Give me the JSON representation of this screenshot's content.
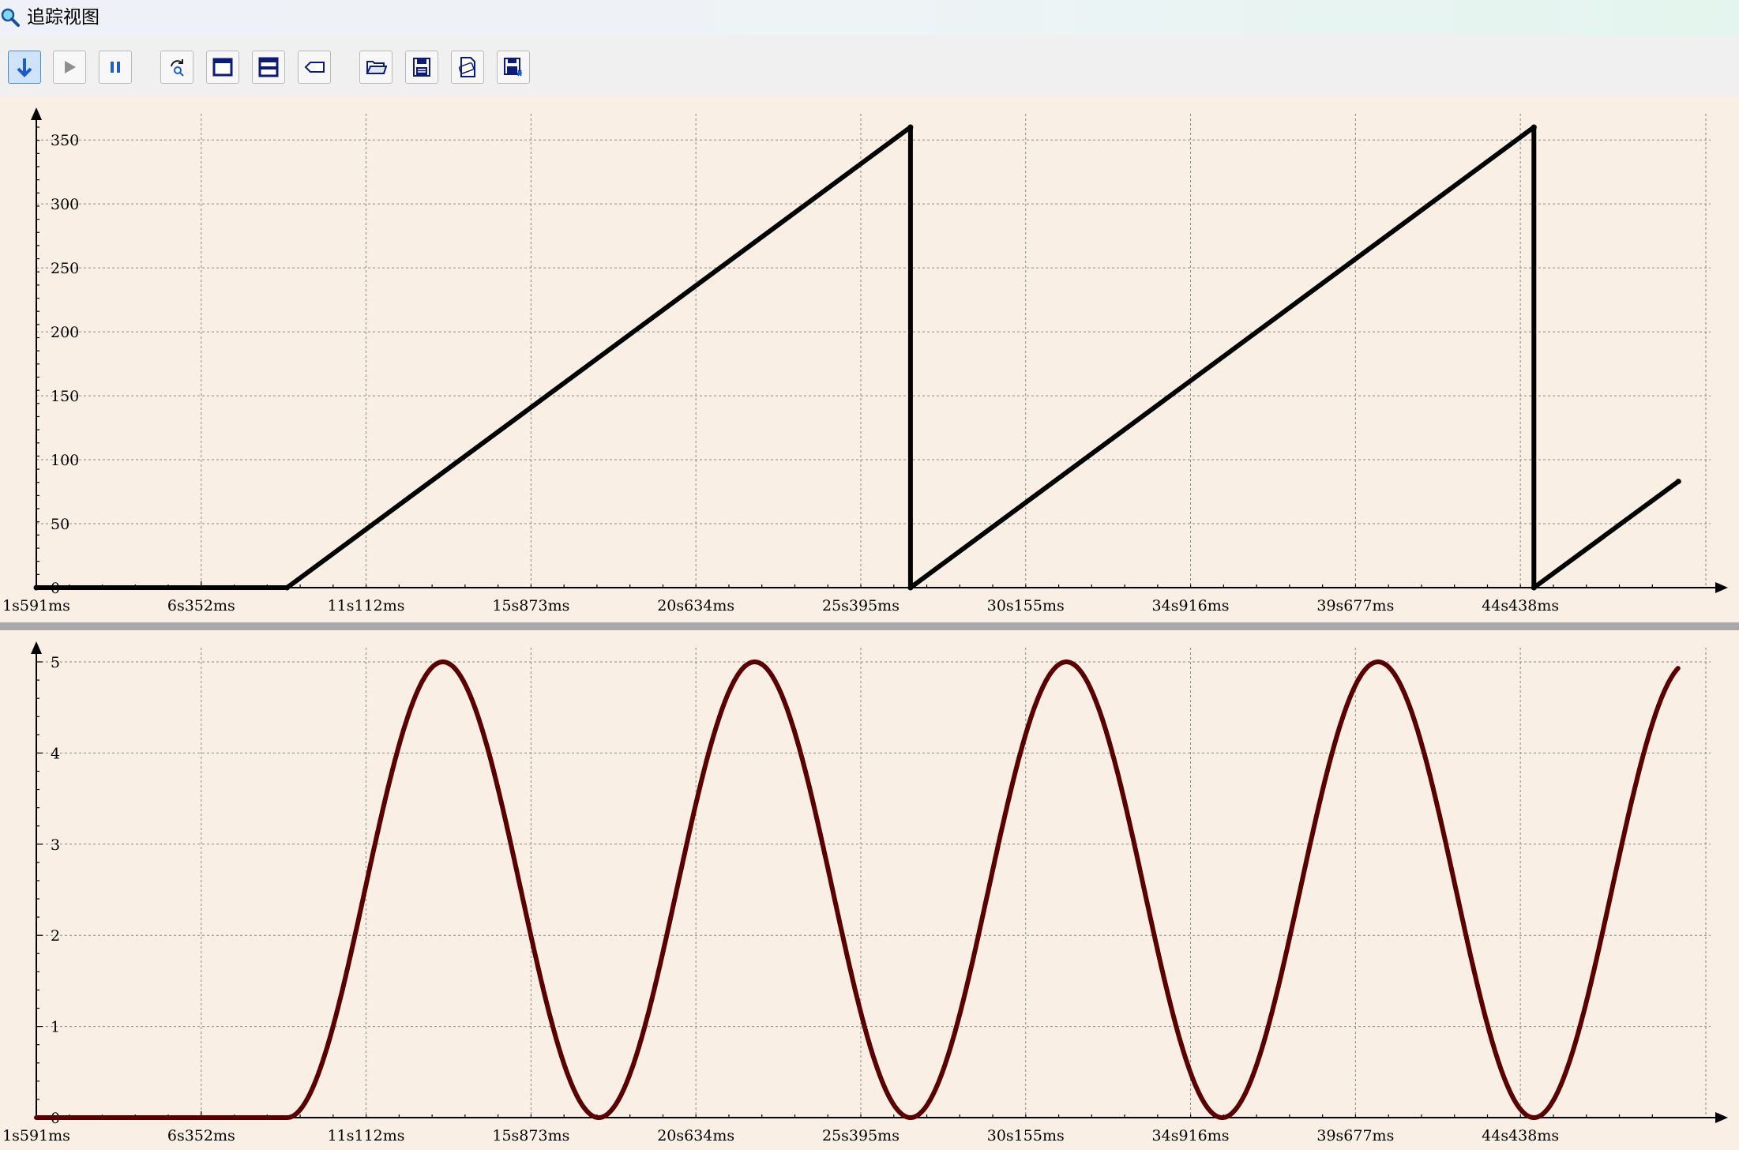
{
  "window": {
    "title": "追踪视图"
  },
  "toolbar": {
    "buttons": [
      {
        "name": "scroll-down-button",
        "icon": "arrow-down-icon",
        "active": true
      },
      {
        "name": "run-button",
        "icon": "play-icon",
        "active": false
      },
      {
        "name": "pause-button",
        "icon": "pause-icon",
        "active": false
      },
      {
        "name": "refresh-button",
        "icon": "refresh-icon",
        "active": false
      },
      {
        "name": "single-view-button",
        "icon": "single-window-icon",
        "active": false
      },
      {
        "name": "split-view-button",
        "icon": "split-window-icon",
        "active": false
      },
      {
        "name": "tag-button",
        "icon": "tag-icon",
        "active": false
      },
      {
        "name": "open-button",
        "icon": "folder-open-icon",
        "active": false
      },
      {
        "name": "save-button",
        "icon": "save-icon",
        "active": false
      },
      {
        "name": "export-csv-button",
        "icon": "csv-file-icon",
        "active": false
      },
      {
        "name": "save-as-button",
        "icon": "save-as-icon",
        "active": false
      }
    ]
  },
  "colors": {
    "background": "#f9efe4",
    "grid": "#8a8a8a",
    "axis": "#000000"
  },
  "chart_data": [
    {
      "type": "line",
      "grid": true,
      "x_tick_labels": [
        "1s591ms",
        "6s352ms",
        "11s112ms",
        "15s873ms",
        "20s634ms",
        "25s395ms",
        "30s155ms",
        "34s916ms",
        "39s677ms",
        "44s438ms"
      ],
      "x_tick_values_ms": [
        1591,
        6352,
        11112,
        15873,
        20634,
        25395,
        30155,
        34916,
        39677,
        44438
      ],
      "xlim_ms": [
        1591,
        49200
      ],
      "ylim": [
        0,
        360
      ],
      "y_ticks": [
        0,
        50,
        100,
        150,
        200,
        250,
        300,
        350
      ],
      "y_tick_labels": [
        "0",
        "50",
        "100",
        "150",
        "200",
        "250",
        "300",
        "350"
      ],
      "series": [
        {
          "color": "#000000",
          "points_ms": [
            [
              1591,
              0
            ],
            [
              8830,
              0
            ],
            [
              26830,
              360
            ],
            [
              26830,
              0
            ],
            [
              44830,
              360
            ],
            [
              44830,
              0
            ],
            [
              49000,
              83
            ]
          ]
        }
      ]
    },
    {
      "type": "line",
      "grid": true,
      "x_tick_labels": [
        "1s591ms",
        "6s352ms",
        "11s112ms",
        "15s873ms",
        "20s634ms",
        "25s395ms",
        "30s155ms",
        "34s916ms",
        "39s677ms",
        "44s438ms"
      ],
      "x_tick_values_ms": [
        1591,
        6352,
        11112,
        15873,
        20634,
        25395,
        30155,
        34916,
        39677,
        44438
      ],
      "xlim_ms": [
        1591,
        49200
      ],
      "ylim": [
        0,
        5
      ],
      "y_ticks": [
        0,
        1,
        2,
        3,
        4,
        5
      ],
      "y_tick_labels": [
        "0",
        "1",
        "2",
        "3",
        "4",
        "5"
      ],
      "series": [
        {
          "color": "#5a0000",
          "flat_until_ms": 8830,
          "amplitude": 2.5,
          "offset": 2.5,
          "period_ms": 9000,
          "first_peak_ms": 13330,
          "end_ms": 49000,
          "end_value": 4.88
        }
      ]
    }
  ]
}
